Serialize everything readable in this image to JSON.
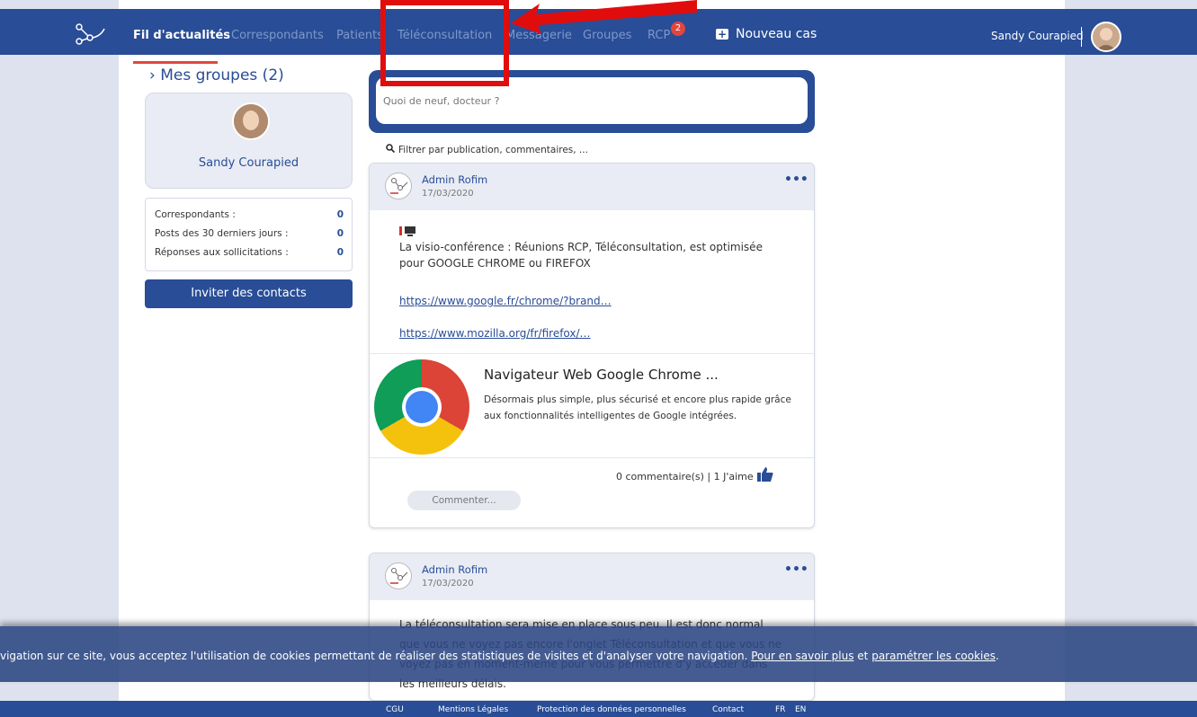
{
  "header": {
    "nav": [
      {
        "label": "Fil d'actualités",
        "active": true
      },
      {
        "label": "Correspondants"
      },
      {
        "label": "Patients"
      },
      {
        "label": "Téléconsultation"
      },
      {
        "label": "Messagerie"
      },
      {
        "label": "Groupes"
      },
      {
        "label": "RCP",
        "badge": "2"
      }
    ],
    "new_case": "Nouveau cas",
    "user_name": "Sandy Courapied"
  },
  "sidebar": {
    "groups_title": "Mes groupes (2)",
    "profile_name": "Sandy Courapied",
    "stats": [
      {
        "label": "Correspondants :",
        "value": "0"
      },
      {
        "label": "Posts des 30 derniers jours :",
        "value": "0"
      },
      {
        "label": "Réponses aux sollicitations :",
        "value": "0"
      }
    ],
    "invite_label": "Inviter des contacts"
  },
  "composer": {
    "placeholder": "Quoi de neuf, docteur ?"
  },
  "filter": {
    "label": "Filtrer par publication, commentaires, ..."
  },
  "posts": [
    {
      "author": "Admin Rofim",
      "date": "17/03/2020",
      "text": "La visio-conférence : Réunions RCP, Téléconsultation, est optimisée pour GOOGLE CHROME ou FIREFOX",
      "links": [
        "https://www.google.fr/chrome/?brand…",
        "https://www.mozilla.org/fr/firefox/…"
      ],
      "preview_title": "Navigateur Web Google Chrome ...",
      "preview_desc": "Désormais plus simple, plus sécurisé et encore plus rapide grâce aux fonctionnalités intelligentes de Google intégrées.",
      "counts": "0 commentaire(s) | 1 J'aime",
      "comment_label": "Commenter..."
    },
    {
      "author": "Admin Rofim",
      "date": "17/03/2020",
      "text": "La téléconsultation sera mise en place sous peu. Il est donc normal que vous ne voyez pas encore l'onglet Téléconsultation et que vous ne voyez pas en moment-même pour vous permettre d'y accéder dans les meilleurs délais."
    }
  ],
  "cookie": {
    "text": "vigation sur ce site, vous acceptez l'utilisation de cookies permettant de réaliser des statistiques de visites et d'analyser votre navigation. ",
    "link1": "Pour en savoir plus",
    "and": " et ",
    "link2": "paramétrer les cookies",
    "end": "."
  },
  "footer": {
    "items": [
      "CGU",
      "Mentions Légales",
      "Protection des données personnelles",
      "Contact"
    ],
    "lang_fr": "FR",
    "lang_en": "EN"
  },
  "colors": {
    "primary": "#294d96",
    "accent": "#e2453f",
    "annotation": "#e10d0d"
  },
  "icons": [
    "network-logo-icon",
    "plus-square-icon",
    "search-icon",
    "more-dots-icon",
    "thumbs-up-icon",
    "chrome-logo-icon"
  ]
}
